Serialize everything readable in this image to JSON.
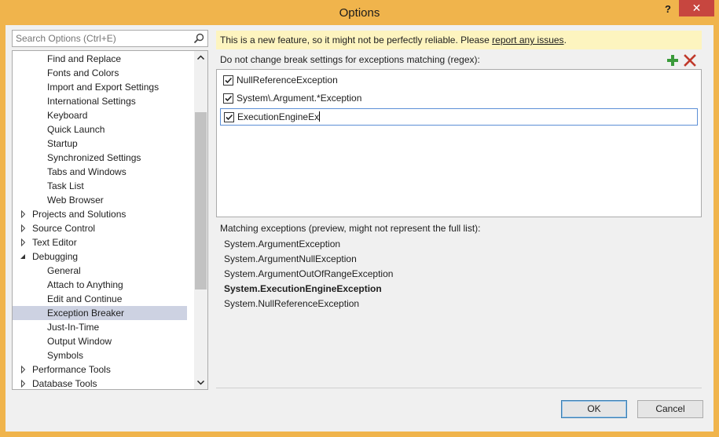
{
  "window": {
    "title": "Options",
    "help_label": "?",
    "close_label": "✕"
  },
  "search": {
    "placeholder": "Search Options (Ctrl+E)",
    "value": ""
  },
  "tree": {
    "items": [
      {
        "label": "Find and Replace",
        "level": 2
      },
      {
        "label": "Fonts and Colors",
        "level": 2
      },
      {
        "label": "Import and Export Settings",
        "level": 2
      },
      {
        "label": "International Settings",
        "level": 2
      },
      {
        "label": "Keyboard",
        "level": 2
      },
      {
        "label": "Quick Launch",
        "level": 2
      },
      {
        "label": "Startup",
        "level": 2
      },
      {
        "label": "Synchronized Settings",
        "level": 2
      },
      {
        "label": "Tabs and Windows",
        "level": 2
      },
      {
        "label": "Task List",
        "level": 2
      },
      {
        "label": "Web Browser",
        "level": 2
      },
      {
        "label": "Projects and Solutions",
        "level": 1,
        "expander": "collapsed"
      },
      {
        "label": "Source Control",
        "level": 1,
        "expander": "collapsed"
      },
      {
        "label": "Text Editor",
        "level": 1,
        "expander": "collapsed"
      },
      {
        "label": "Debugging",
        "level": 1,
        "expander": "expanded"
      },
      {
        "label": "General",
        "level": 2
      },
      {
        "label": "Attach to Anything",
        "level": 2
      },
      {
        "label": "Edit and Continue",
        "level": 2
      },
      {
        "label": "Exception Breaker",
        "level": 2,
        "selected": true
      },
      {
        "label": "Just-In-Time",
        "level": 2
      },
      {
        "label": "Output Window",
        "level": 2
      },
      {
        "label": "Symbols",
        "level": 2
      },
      {
        "label": "Performance Tools",
        "level": 1,
        "expander": "collapsed"
      },
      {
        "label": "Database Tools",
        "level": 1,
        "expander": "collapsed"
      }
    ]
  },
  "banner": {
    "text": "This is a new feature, so it might not be perfectly reliable. Please ",
    "link": "report any issues",
    "suffix": "."
  },
  "patterns": {
    "label": "Do not change break settings for exceptions matching (regex):",
    "add_icon": "plus-icon",
    "remove_icon": "x-icon",
    "items": [
      {
        "text": "NullReferenceException",
        "checked": true
      },
      {
        "text": "System\\.Argument.*Exception",
        "checked": true
      },
      {
        "text": "ExecutionEngineEx",
        "checked": true,
        "editing": true
      }
    ]
  },
  "matching": {
    "label": "Matching exceptions (preview, might not represent the full list):",
    "items": [
      {
        "text": "System.ArgumentException",
        "bold": false
      },
      {
        "text": "System.ArgumentNullException",
        "bold": false
      },
      {
        "text": "System.ArgumentOutOfRangeException",
        "bold": false
      },
      {
        "text": "System.ExecutionEngineException",
        "bold": true
      },
      {
        "text": "System.NullReferenceException",
        "bold": false
      }
    ]
  },
  "buttons": {
    "ok": "OK",
    "cancel": "Cancel"
  },
  "colors": {
    "title_bar": "#f0b44c",
    "close": "#c7463f",
    "selection": "#cdd2e2",
    "banner": "#fdf4bf",
    "add": "#3a9a3a",
    "remove": "#c0392b"
  }
}
